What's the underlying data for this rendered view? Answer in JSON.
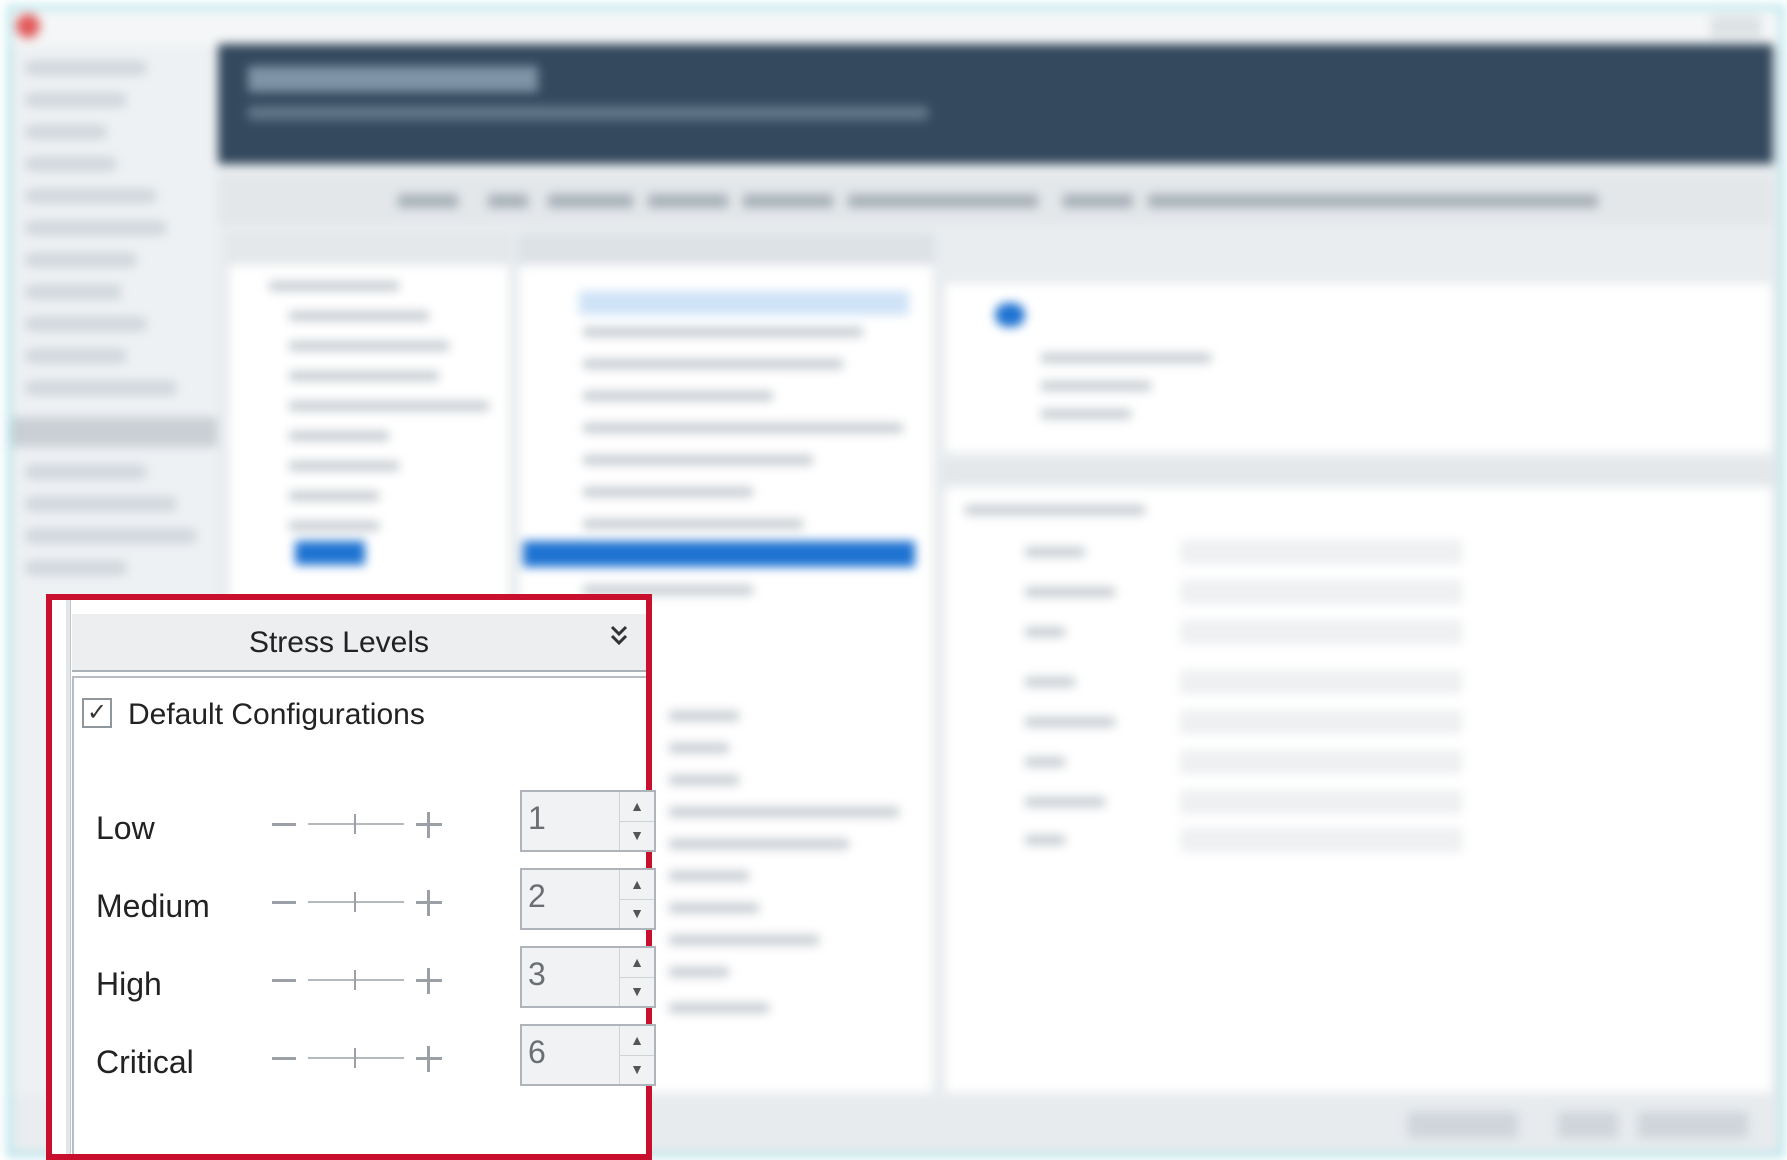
{
  "panel": {
    "title": "Stress Levels",
    "collapse_icon": "double-chevron-down-icon",
    "default_config": {
      "label": "Default Configurations",
      "checked": true,
      "check_glyph": "✓"
    },
    "levels": [
      {
        "label": "Low",
        "value": "1"
      },
      {
        "label": "Medium",
        "value": "2"
      },
      {
        "label": "High",
        "value": "3"
      },
      {
        "label": "Critical",
        "value": "6"
      }
    ]
  },
  "colors": {
    "highlight_border": "#c8102e",
    "header_bg": "#34495e",
    "selection_blue": "#1e73d2",
    "window_border": "#4ec7d6"
  }
}
